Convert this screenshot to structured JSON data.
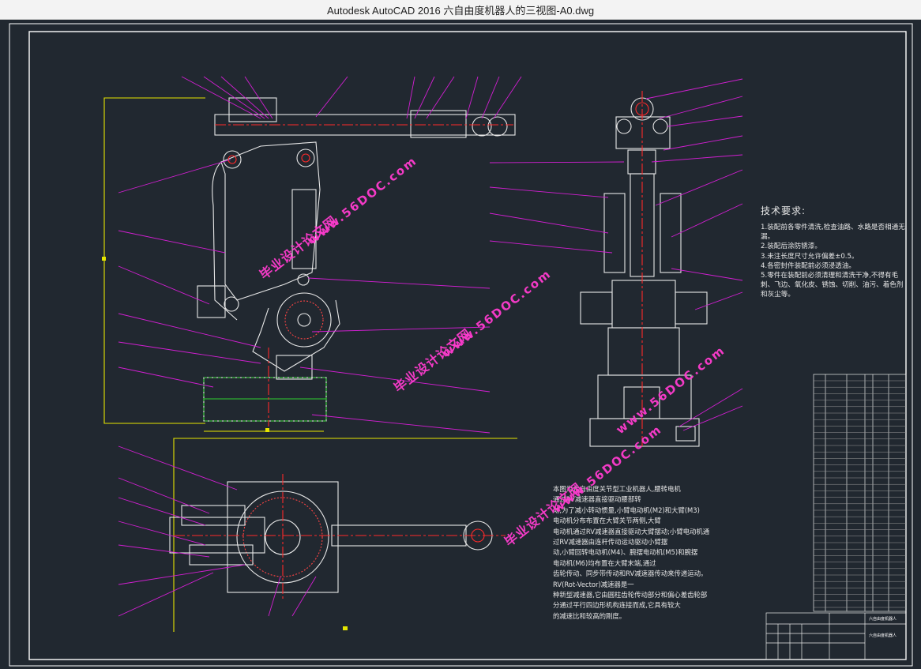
{
  "window": {
    "title": "Autodesk AutoCAD 2016     六自由度机器人的三视图-A0.dwg"
  },
  "colors": {
    "background": "#212830",
    "frame": "#ffffff",
    "leader": "#d21fd2",
    "dimension": "#e6e600",
    "centerline": "#ff2a2a",
    "parts": "#e8e8e8",
    "section": "#2fd12f",
    "watermark": "#ff3ccf"
  },
  "watermarks": {
    "site_cn": "毕业设计论文网",
    "site_url": "www.56DOC.com"
  },
  "technical_requirements": {
    "heading": "技术要求:",
    "items": [
      "1.装配前各零件清洗,检查油路、水路是否相通无漏。",
      "2.装配后涂防锈漆。",
      "3.未注长度尺寸允许偏差±0.5。",
      "4.各密封件装配前必须浸透油。",
      "5.零件在装配前必须清理和清洗干净,不得有毛刺、飞边、氧化皮、锈蚀、切削、油污、着色剂和灰尘等。"
    ]
  },
  "description": {
    "lines": [
      "本图为六自由度关节型工业机器人,腰转电机",
      "通过RV减速器直接驱动腰部转",
      "动,为了减小转动惯量,小臂电动机(M2)和大臂(M3)",
      "电动机分布布置在大臂关节两侧,大臂",
      "电动机通过RV减速器直接驱动大臂摆动;小臂电动机通",
      "过RV减速器由连杆传动运动驱动小臂摆",
      "动,小臂回转电动机(M4)、腕摆电动机(M5)和腕摆",
      "电动机(M6)均布置在大臂末端,通过",
      "齿轮传动、同步带传动和RV减速器传动来传递运动。",
      "RV(Rot-Vector)减速器是一",
      "种新型减速器,它由圆柱齿轮传动部分和偏心差齿轮部",
      "分通过平行四边形机构连接而成,它具有较大",
      "的减速比和较高的刚度。"
    ]
  },
  "title_block": {
    "drawing_name": "六自由度机器人",
    "header_label": "六自由度机器人"
  }
}
